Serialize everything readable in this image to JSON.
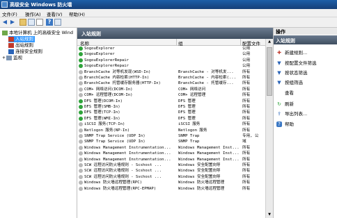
{
  "title_bar": {
    "title": "高级安全 Windows 防火墙"
  },
  "menu": [
    "文件(F)",
    "操作(A)",
    "查看(V)",
    "帮助(H)"
  ],
  "tree": {
    "root": "本地计算机 上的高级安全 Wind",
    "items": [
      "入站规则",
      "出站规则",
      "连接安全规则",
      "监视"
    ]
  },
  "center": {
    "header": "入站规则",
    "columns": [
      "名称",
      "组",
      "配置文件"
    ],
    "rows": [
      {
        "name": "SogouExplorer",
        "group": "",
        "profile": "公用",
        "enabled": true
      },
      {
        "name": "SogouExplorer",
        "group": "",
        "profile": "公用",
        "enabled": true
      },
      {
        "name": "SogouExplorerRepair",
        "group": "",
        "profile": "公用",
        "enabled": true
      },
      {
        "name": "SogouExplorerRepair",
        "group": "",
        "profile": "公用",
        "enabled": true
      },
      {
        "name": "BranchCache 对等机发现(WSD-In)",
        "group": "BranchCache - 对等机发...",
        "profile": "所有",
        "enabled": false
      },
      {
        "name": "BranchCache 内容检索(HTTP-In)",
        "group": "BranchCache - 内容检索(...",
        "profile": "所有",
        "enabled": false
      },
      {
        "name": "BranchCache 托管缓存服务器(HTTP-In)",
        "group": "BranchCache - 托管缓存...",
        "profile": "所有",
        "enabled": false
      },
      {
        "name": "COM+ 网络访问(DCOM-In)",
        "group": "COM+ 网络访问",
        "profile": "所有",
        "enabled": false
      },
      {
        "name": "COM+ 远程管理(DCOM-In)",
        "group": "COM+ 远程管理",
        "profile": "所有",
        "enabled": false
      },
      {
        "name": "DFS 管理(DCOM-In)",
        "group": "DFS 管理",
        "profile": "所有",
        "enabled": true
      },
      {
        "name": "DFS 管理(SMB-In)",
        "group": "DFS 管理",
        "profile": "所有",
        "enabled": true
      },
      {
        "name": "DFS 管理(TCP-In)",
        "group": "DFS 管理",
        "profile": "所有",
        "enabled": true
      },
      {
        "name": "DFS 管理(WMI-In)",
        "group": "DFS 管理",
        "profile": "所有",
        "enabled": true
      },
      {
        "name": "iSCSI 服务(TCP-In)",
        "group": "iSCSI 服务",
        "profile": "所有",
        "enabled": false
      },
      {
        "name": "Netlogon 服务(NP-In)",
        "group": "Netlogon 服务",
        "profile": "所有",
        "enabled": false
      },
      {
        "name": "SNMP Trap Service (UDP In)",
        "group": "SNMP Trap",
        "profile": "专用, 公",
        "enabled": false
      },
      {
        "name": "SNMP Trap Service (UDP In)",
        "group": "SNMP Trap",
        "profile": "域",
        "enabled": false
      },
      {
        "name": "Windows Management Instrumentation...",
        "group": "Windows Management Inst...",
        "profile": "所有",
        "enabled": false
      },
      {
        "name": "Windows Management Instrumentation...",
        "group": "Windows Management Inst...",
        "profile": "所有",
        "enabled": false
      },
      {
        "name": "Windows Management Instrumentation...",
        "group": "Windows Management Inst...",
        "profile": "所有",
        "enabled": false
      },
      {
        "name": "SCW 远程访问防火墙规则 - Scshost ...",
        "group": "Windows 安全配置向导",
        "profile": "所有",
        "enabled": false
      },
      {
        "name": "SCW 远程访问防火墙规则 - Scshost ...",
        "group": "Windows 安全配置向导",
        "profile": "所有",
        "enabled": false
      },
      {
        "name": "SCW 远程访问防火墙规则 - Svchost ...",
        "group": "Windows 安全配置向导",
        "profile": "所有",
        "enabled": false
      },
      {
        "name": "Windows 防火墙远程管理(RPC)",
        "group": "Windows 防火墙远程管理",
        "profile": "所有",
        "enabled": false
      },
      {
        "name": "Windows 防火墙远程管理(RPC-EPMAP)",
        "group": "Windows 防火墙远程管理",
        "profile": "所有",
        "enabled": false
      }
    ]
  },
  "actions": {
    "header": "操作",
    "section": "入站规则",
    "items": [
      {
        "label": "新建规则...",
        "icon": "new-rule-icon"
      },
      {
        "label": "按配置文件筛选",
        "icon": "filter-icon"
      },
      {
        "label": "按状态筛选",
        "icon": "filter-icon"
      },
      {
        "label": "按组筛选",
        "icon": "filter-icon"
      },
      {
        "label": "查看",
        "icon": "view-icon"
      },
      {
        "label": "刷新",
        "icon": "refresh-icon"
      },
      {
        "label": "导出列表...",
        "icon": "export-icon"
      },
      {
        "label": "帮助",
        "icon": "help-icon"
      }
    ]
  }
}
